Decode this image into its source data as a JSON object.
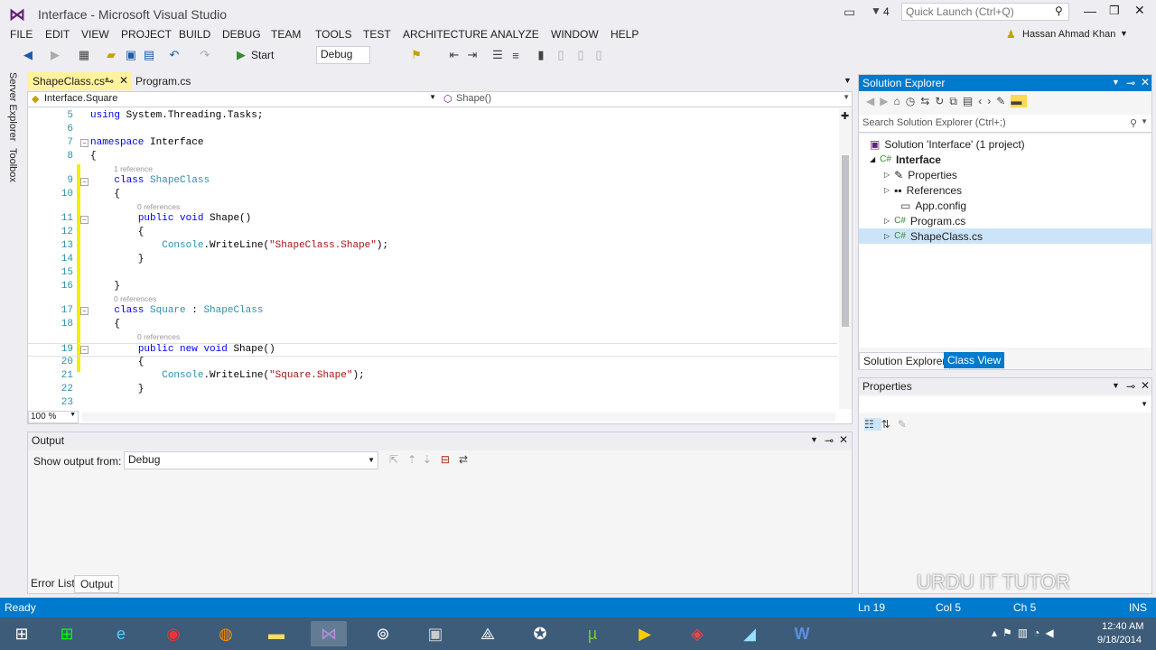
{
  "window": {
    "title": "Interface - Microsoft Visual Studio",
    "notification_count": "4",
    "quick_launch_placeholder": "Quick Launch (Ctrl+Q)",
    "user": "Hassan Ahmad Khan"
  },
  "menu": [
    "FILE",
    "EDIT",
    "VIEW",
    "PROJECT",
    "BUILD",
    "DEBUG",
    "TEAM",
    "TOOLS",
    "TEST",
    "ARCHITECTURE",
    "ANALYZE",
    "WINDOW",
    "HELP"
  ],
  "toolbar": {
    "start_label": "Start",
    "config": "Debug"
  },
  "left_strip": [
    "Server Explorer",
    "Toolbox"
  ],
  "doc_tabs": [
    {
      "label": "ShapeClass.cs*",
      "active": true
    },
    {
      "label": "Program.cs",
      "active": false
    }
  ],
  "navbar": {
    "class": "Interface.Square",
    "member": "Shape()"
  },
  "code": [
    {
      "ln": "5",
      "text": "using System.Threading.Tasks;"
    },
    {
      "ln": "6",
      "text": ""
    },
    {
      "ln": "7",
      "text": "namespace Interface"
    },
    {
      "ln": "8",
      "text": "{"
    },
    {
      "ref": "1 reference"
    },
    {
      "ln": "9",
      "text": "    class ShapeClass"
    },
    {
      "ln": "10",
      "text": "    {"
    },
    {
      "ref": "0 references"
    },
    {
      "ln": "11",
      "text": "        public void Shape()"
    },
    {
      "ln": "12",
      "text": "        {"
    },
    {
      "ln": "13",
      "text": "            Console.WriteLine(\"ShapeClass.Shape\");"
    },
    {
      "ln": "14",
      "text": "        }"
    },
    {
      "ln": "15",
      "text": ""
    },
    {
      "ln": "16",
      "text": "    }"
    },
    {
      "ref": "0 references"
    },
    {
      "ln": "17",
      "text": "    class Square : ShapeClass"
    },
    {
      "ln": "18",
      "text": "    {"
    },
    {
      "ref": "0 references"
    },
    {
      "ln": "19",
      "text": "        public new void Shape()"
    },
    {
      "ln": "20",
      "text": "        {"
    },
    {
      "ln": "21",
      "text": "            Console.WriteLine(\"Square.Shape\");"
    },
    {
      "ln": "22",
      "text": "        }"
    },
    {
      "ln": "23",
      "text": ""
    }
  ],
  "zoom": "100 %",
  "output": {
    "title": "Output",
    "show_label": "Show output from:",
    "source": "Debug"
  },
  "bottom_tabs": [
    "Error List",
    "Output"
  ],
  "solution_explorer": {
    "title": "Solution Explorer",
    "search_placeholder": "Search Solution Explorer (Ctrl+;)",
    "items": [
      "Solution 'Interface' (1 project)",
      "Interface",
      "Properties",
      "References",
      "App.config",
      "Program.cs",
      "ShapeClass.cs"
    ],
    "tabs": [
      "Solution Explorer",
      "Class View"
    ]
  },
  "properties": {
    "title": "Properties"
  },
  "status": {
    "left": "Ready",
    "ln": "Ln 19",
    "col": "Col 5",
    "ch": "Ch 5",
    "mode": "INS"
  },
  "watermark": "URDU IT TUTOR",
  "clock": {
    "time": "12:40 AM",
    "date": "9/18/2014"
  },
  "colors": {
    "accent": "#007acc",
    "highlight": "#efef00"
  }
}
